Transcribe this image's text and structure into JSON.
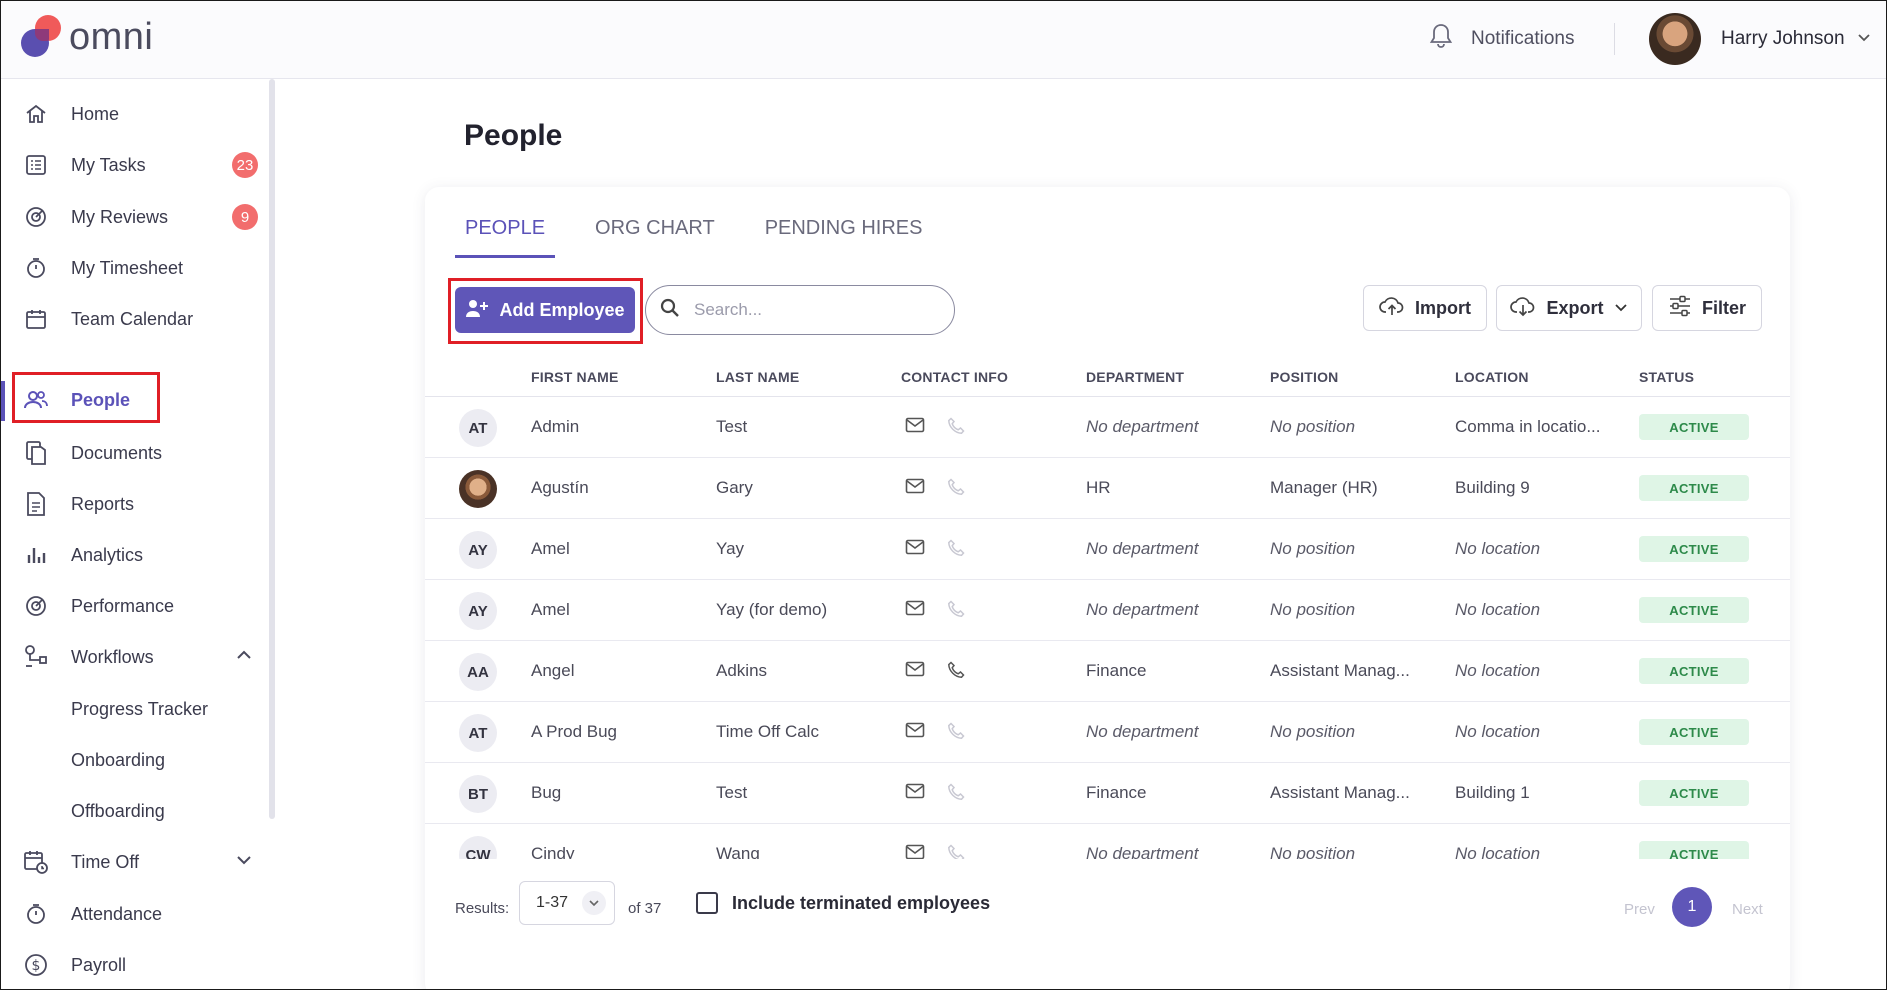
{
  "app": {
    "logo_text": "omni"
  },
  "header": {
    "notifications_label": "Notifications",
    "user_name": "Harry Johnson"
  },
  "sidebar": {
    "items": [
      {
        "label": "Home",
        "icon": "home-icon"
      },
      {
        "label": "My Tasks",
        "icon": "tasks-icon",
        "badge": "23"
      },
      {
        "label": "My Reviews",
        "icon": "reviews-icon",
        "badge": "9"
      },
      {
        "label": "My Timesheet",
        "icon": "stopwatch-icon"
      },
      {
        "label": "Team Calendar",
        "icon": "calendar-icon"
      },
      {
        "label": "People",
        "icon": "people-icon",
        "active": true
      },
      {
        "label": "Documents",
        "icon": "documents-icon"
      },
      {
        "label": "Reports",
        "icon": "reports-icon"
      },
      {
        "label": "Analytics",
        "icon": "analytics-icon"
      },
      {
        "label": "Performance",
        "icon": "performance-icon"
      },
      {
        "label": "Workflows",
        "icon": "workflows-icon",
        "expanded": true
      },
      {
        "label": "Progress Tracker",
        "sub": true
      },
      {
        "label": "Onboarding",
        "sub": true
      },
      {
        "label": "Offboarding",
        "sub": true
      },
      {
        "label": "Time Off",
        "icon": "time-off-icon",
        "expanded": false
      },
      {
        "label": "Attendance",
        "icon": "stopwatch-icon"
      },
      {
        "label": "Payroll",
        "icon": "dollar-icon"
      }
    ]
  },
  "main": {
    "title": "People",
    "tabs": [
      "PEOPLE",
      "ORG CHART",
      "PENDING HIRES"
    ],
    "add_employee_label": "Add Employee",
    "search_placeholder": "Search...",
    "import_label": "Import",
    "export_label": "Export",
    "filter_label": "Filter",
    "columns": [
      "FIRST NAME",
      "LAST NAME",
      "CONTACT INFO",
      "DEPARTMENT",
      "POSITION",
      "LOCATION",
      "STATUS"
    ],
    "rows": [
      {
        "initials": "AT",
        "first": "Admin",
        "last": "Test",
        "dept": "No department",
        "pos": "No position",
        "loc": "Comma in locatio...",
        "status": "ACTIVE",
        "phone": false
      },
      {
        "initials": "",
        "photo": true,
        "first": "Agustín",
        "last": "Gary",
        "dept": "HR",
        "pos": "Manager (HR)",
        "loc": "Building 9",
        "status": "ACTIVE",
        "phone": false
      },
      {
        "initials": "AY",
        "first": "Amel",
        "last": "Yay",
        "dept": "No department",
        "pos": "No position",
        "loc": "No location",
        "status": "ACTIVE",
        "phone": false
      },
      {
        "initials": "AY",
        "first": "Amel",
        "last": "Yay (for demo)",
        "dept": "No department",
        "pos": "No position",
        "loc": "No location",
        "status": "ACTIVE",
        "phone": false
      },
      {
        "initials": "AA",
        "first": "Angel",
        "last": "Adkins",
        "dept": "Finance",
        "pos": "Assistant Manag...",
        "loc": "No location",
        "status": "ACTIVE",
        "phone": true
      },
      {
        "initials": "AT",
        "first": "A Prod Bug",
        "last": "Time Off Calc",
        "dept": "No department",
        "pos": "No position",
        "loc": "No location",
        "status": "ACTIVE",
        "phone": false
      },
      {
        "initials": "BT",
        "first": "Bug",
        "last": "Test",
        "dept": "Finance",
        "pos": "Assistant Manag...",
        "loc": "Building 1",
        "status": "ACTIVE",
        "phone": false
      },
      {
        "initials": "CW",
        "first": "Cindy",
        "last": "Wang",
        "dept": "No department",
        "pos": "No position",
        "loc": "No location",
        "status": "ACTIVE",
        "phone": false
      }
    ],
    "footer": {
      "results_label": "Results:",
      "results_range": "1-37",
      "results_total": "of 37",
      "include_terminated_label": "Include terminated employees",
      "prev_label": "Prev",
      "page": "1",
      "next_label": "Next"
    }
  },
  "colors": {
    "accent": "#5f56b8",
    "badge": "#f26d6d",
    "active_pill_bg": "#dff5e6",
    "active_pill_fg": "#2d8a4a",
    "highlight_box": "#e01f26"
  }
}
